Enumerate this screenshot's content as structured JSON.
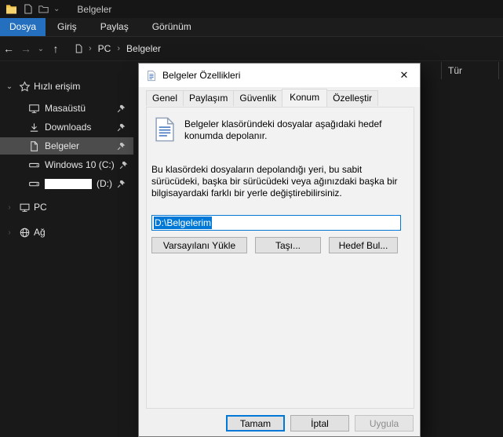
{
  "colors": {
    "accent_blue": "#2470be",
    "selection_blue": "#0078d7",
    "sidebar_selection": "#4c4c4c",
    "dialog_background": "#f0f0f0"
  },
  "titlebar": {
    "title": "Belgeler"
  },
  "ribbon": {
    "tabs": [
      "Dosya",
      "Giriş",
      "Paylaş",
      "Görünüm"
    ],
    "active_tab": "Dosya"
  },
  "navbar": {
    "breadcrumb": [
      "PC",
      "Belgeler"
    ]
  },
  "icons": {
    "back": "←",
    "forward": "→",
    "up": "↑",
    "chevron_down": "⌄",
    "chevron_right": "›",
    "close": "✕"
  },
  "sidebar": {
    "items": [
      {
        "label": "Hızlı erişim",
        "icon": "star-icon",
        "expanded": true
      },
      {
        "label": "Masaüstü",
        "icon": "monitor-icon",
        "pinned": true
      },
      {
        "label": "Downloads",
        "icon": "download-icon",
        "pinned": true
      },
      {
        "label": "Belgeler",
        "icon": "document-icon",
        "pinned": true,
        "selected": true
      },
      {
        "label": "Windows 10 (C:)",
        "icon": "drive-icon",
        "pinned": true
      },
      {
        "label": "(D:)",
        "icon": "drive-icon",
        "pinned": true,
        "redacted": true
      },
      {
        "label": "PC",
        "icon": "pc-icon"
      },
      {
        "label": "Ağ",
        "icon": "network-icon"
      }
    ]
  },
  "file_list": {
    "column_header": "Tür"
  },
  "dialog": {
    "title": "Belgeler Özellikleri",
    "tabs": [
      "Genel",
      "Paylaşım",
      "Güvenlik",
      "Konum",
      "Özelleştir"
    ],
    "active_tab": "Konum",
    "intro": "Belgeler klasöründeki dosyalar aşağıdaki hedef konumda depolanır.",
    "description": "Bu klasördeki dosyaların depolandığı yeri, bu sabit sürücüdeki, başka bir sürücüdeki veya ağınızdaki başka bir bilgisayardaki farklı bir yerle değiştirebilirsiniz.",
    "path_value": "D:\\Belgelerim",
    "buttons": {
      "restore_default": "Varsayılanı Yükle",
      "move": "Taşı...",
      "find_target": "Hedef Bul..."
    },
    "footer": {
      "ok": "Tamam",
      "cancel": "İptal",
      "apply": "Uygula"
    }
  }
}
